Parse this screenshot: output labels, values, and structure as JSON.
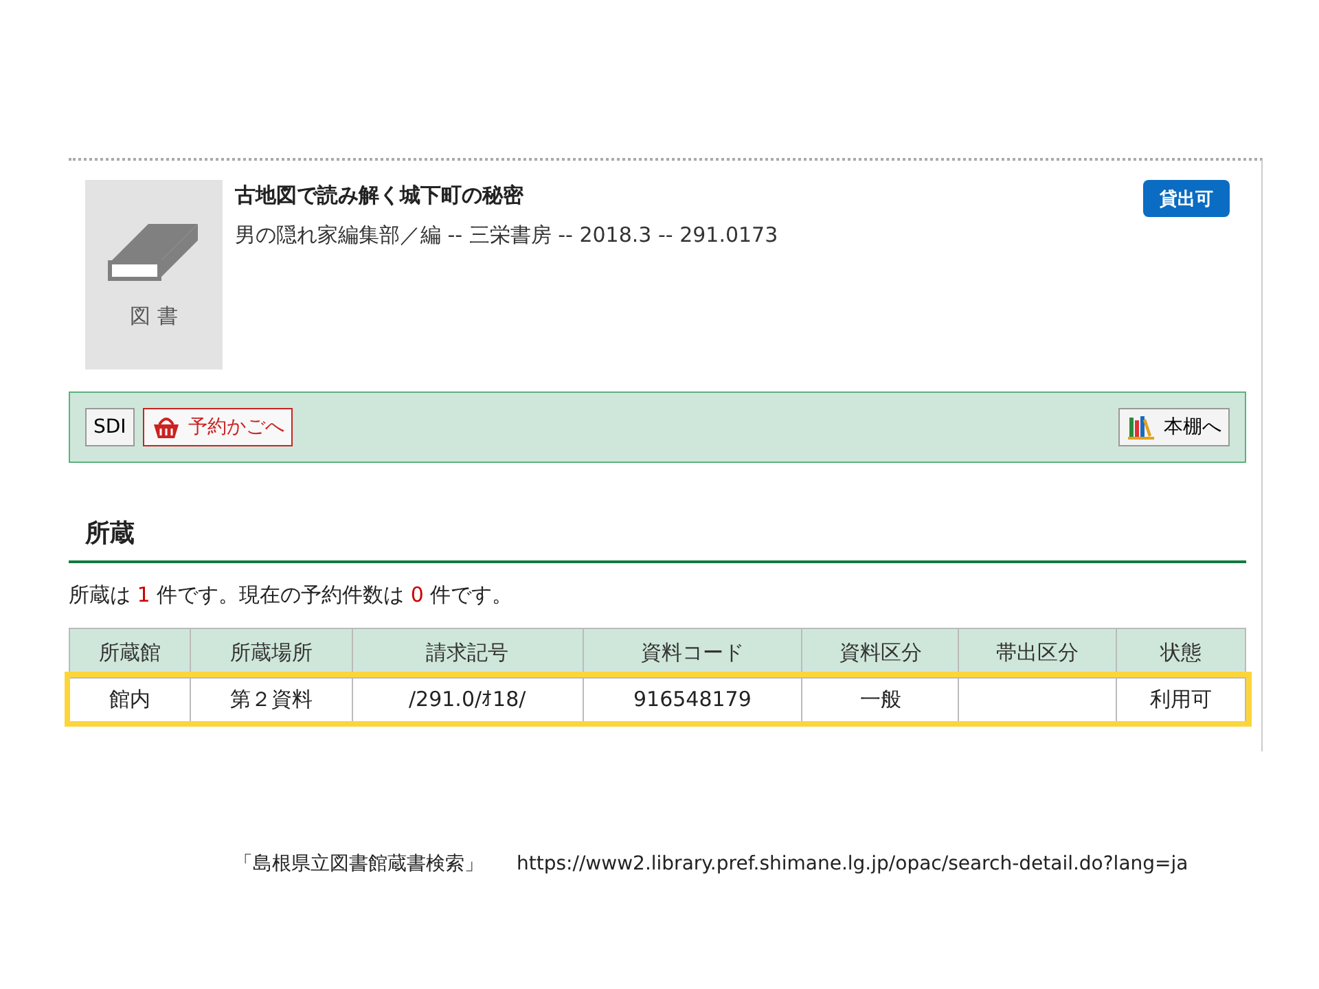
{
  "record": {
    "type_label": "図 書",
    "title": "古地図で読み解く城下町の秘密",
    "details": "男の隠れ家編集部／編 -- 三栄書房 -- 2018.3 -- 291.0173",
    "availability": "貸出可"
  },
  "toolbar": {
    "buttons": [
      {
        "label": "SDI",
        "kind": "plain"
      },
      {
        "label": "予約かごへ",
        "kind": "basket"
      },
      {
        "label": "本棚へ",
        "kind": "shelf"
      }
    ]
  },
  "holdings": {
    "heading": "所蔵",
    "summary": [
      {
        "text": "所蔵は ",
        "kind": "plain"
      },
      {
        "text": "1",
        "kind": "count"
      },
      {
        "text": " 件です。現在の予約件数は ",
        "kind": "plain"
      },
      {
        "text": "0",
        "kind": "count"
      },
      {
        "text": " 件です。",
        "kind": "plain"
      }
    ],
    "table": {
      "columns": [
        "所蔵館",
        "所蔵場所",
        "請求記号",
        "資料コード",
        "資料区分",
        "帯出区分",
        "状態"
      ],
      "rows": [
        {
          "highlighted": true,
          "cells": [
            "館内",
            "第２資料",
            "/291.0/ｵ18/",
            "916548179",
            "一般",
            "",
            "利用可"
          ]
        }
      ]
    }
  },
  "caption": {
    "source": "「島根県立図書館蔵書検索」",
    "url": "https://www2.library.pref.shimane.lg.jp/opac/search-detail.do?lang=ja"
  }
}
